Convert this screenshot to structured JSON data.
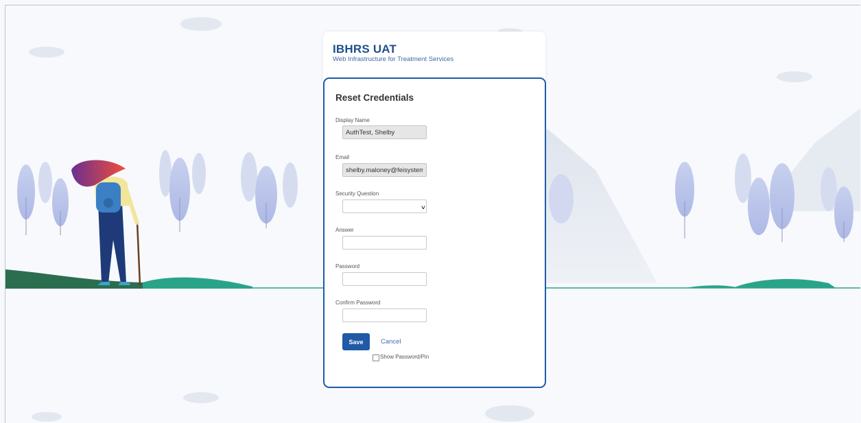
{
  "header": {
    "title": "IBHRS UAT",
    "subtitle": "Web Infrastructure for Treatment Services"
  },
  "form": {
    "title": "Reset Credentials",
    "display_name": {
      "label": "Display Name",
      "value": "AuthTest, Shelby"
    },
    "email": {
      "label": "Email",
      "value": "shelby.maloney@feisystems."
    },
    "security_question": {
      "label": "Security Question",
      "value": ""
    },
    "answer": {
      "label": "Answer",
      "value": ""
    },
    "password": {
      "label": "Password",
      "value": ""
    },
    "confirm_password": {
      "label": "Confirm Password",
      "value": ""
    },
    "save_label": "Save",
    "cancel_label": "Cancel",
    "show_password_label": "Show Password/Pin",
    "show_password_checked": false
  },
  "colors": {
    "accent": "#1f5aa6",
    "brand_title": "#1f4e8c",
    "ground_green": "#2aa489"
  }
}
